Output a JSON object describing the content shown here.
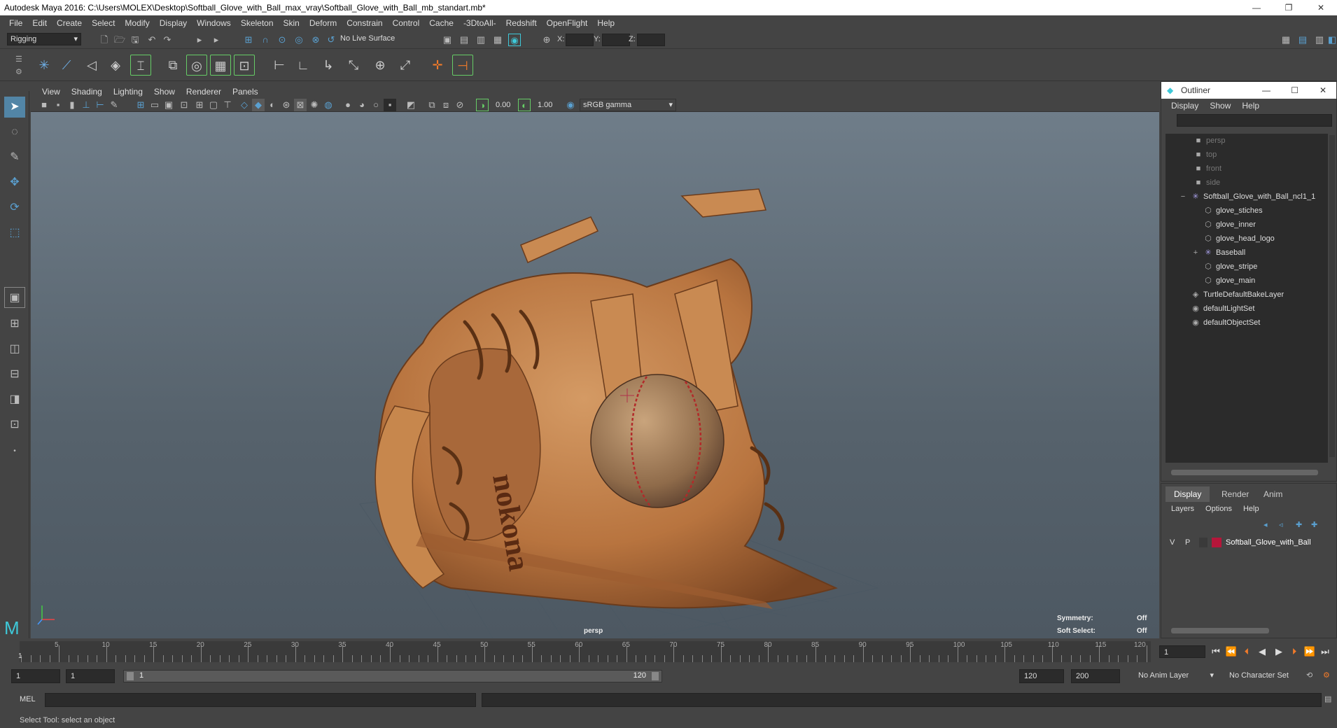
{
  "title_bar": {
    "title": "Autodesk Maya 2016: C:\\Users\\MOLEX\\Desktop\\Softball_Glove_with_Ball_max_vray\\Softball_Glove_with_Ball_mb_standart.mb*",
    "minimize": "—",
    "restore": "❐",
    "close": "✕"
  },
  "menubar": [
    "File",
    "Edit",
    "Create",
    "Select",
    "Modify",
    "Display",
    "Windows",
    "Skeleton",
    "Skin",
    "Deform",
    "Constrain",
    "Control",
    "Cache",
    "-3DtoAll-",
    "Redshift",
    "OpenFlight",
    "Help"
  ],
  "status_line": {
    "mode": "Rigging",
    "live_surface": "No Live Surface",
    "x_label": "X:",
    "y_label": "Y:",
    "z_label": "Z:"
  },
  "panel_menu": [
    "View",
    "Shading",
    "Lighting",
    "Show",
    "Renderer",
    "Panels"
  ],
  "panel_toolbar": {
    "exposure": "0.00",
    "gamma": "1.00",
    "color_space": "sRGB gamma"
  },
  "viewport": {
    "camera_label": "persp",
    "symmetry_label": "Symmetry:",
    "symmetry_value": "Off",
    "soft_select_label": "Soft Select:",
    "soft_select_value": "Off",
    "logo_text": "nokona"
  },
  "outliner": {
    "title": "Outliner",
    "menus": [
      "Display",
      "Show",
      "Help"
    ],
    "items": [
      {
        "label": "persp",
        "depth": 0,
        "icon": "camera-icon",
        "dim": true
      },
      {
        "label": "top",
        "depth": 0,
        "icon": "camera-icon",
        "dim": true
      },
      {
        "label": "front",
        "depth": 0,
        "icon": "camera-icon",
        "dim": true
      },
      {
        "label": "side",
        "depth": 0,
        "icon": "camera-icon",
        "dim": true
      },
      {
        "label": "Softball_Glove_with_Ball_ncl1_1",
        "depth": 0,
        "icon": "group-icon",
        "expander": "−"
      },
      {
        "label": "glove_stiches",
        "depth": 1,
        "icon": "mesh-icon"
      },
      {
        "label": "glove_inner",
        "depth": 1,
        "icon": "mesh-icon"
      },
      {
        "label": "glove_head_logo",
        "depth": 1,
        "icon": "mesh-icon"
      },
      {
        "label": "Baseball",
        "depth": 1,
        "icon": "group-icon",
        "expander": "+"
      },
      {
        "label": "glove_stripe",
        "depth": 1,
        "icon": "mesh-icon"
      },
      {
        "label": "glove_main",
        "depth": 1,
        "icon": "mesh-icon"
      },
      {
        "label": "TurtleDefaultBakeLayer",
        "depth": 0,
        "icon": "layer-icon"
      },
      {
        "label": "defaultLightSet",
        "depth": 0,
        "icon": "set-icon"
      },
      {
        "label": "defaultObjectSet",
        "depth": 0,
        "icon": "set-icon"
      }
    ]
  },
  "layer_editor": {
    "tabs": [
      "Display",
      "Render",
      "Anim"
    ],
    "menus": [
      "Layers",
      "Options",
      "Help"
    ],
    "layer": {
      "v": "V",
      "p": "P",
      "name": "Softball_Glove_with_Ball",
      "color": "#b5163a"
    }
  },
  "time_slider": {
    "ticks": [
      "5",
      "10",
      "15",
      "20",
      "25",
      "30",
      "35",
      "40",
      "45",
      "50",
      "55",
      "60",
      "65",
      "70",
      "75",
      "80",
      "85",
      "90",
      "95",
      "100",
      "105",
      "110",
      "115",
      "120"
    ],
    "first_frame": "1",
    "current_frame": "1"
  },
  "range_slider": {
    "start": "1",
    "playback_start": "1",
    "range_start_label": "1",
    "range_end_label": "120",
    "playback_end": "120",
    "end": "200",
    "anim_layer": "No Anim Layer",
    "character_set": "No Character Set"
  },
  "command_line": {
    "language": "MEL"
  },
  "help_line": {
    "text": "Select Tool: select an object"
  },
  "colors": {
    "ui_bg": "#444444",
    "field_bg": "#2b2b2b",
    "accent": "#5285a6",
    "viewport_top": "#6f7d89"
  }
}
